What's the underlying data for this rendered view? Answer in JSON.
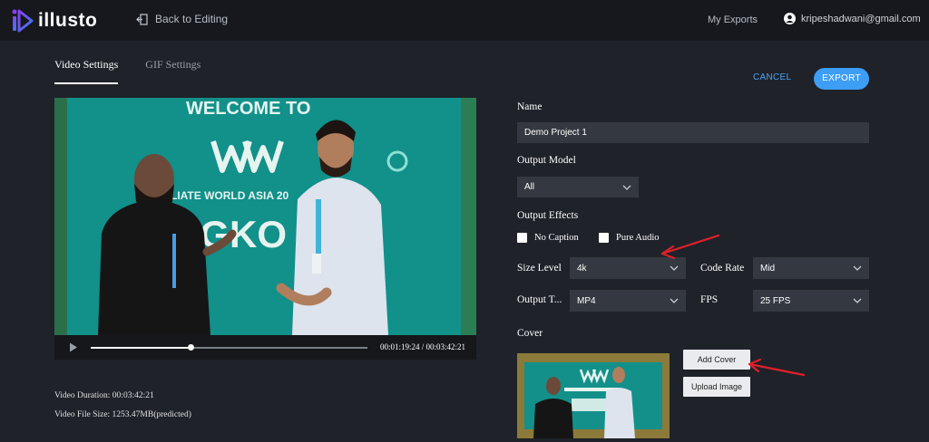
{
  "header": {
    "brand": "illusto",
    "back_label": "Back to Editing",
    "my_exports": "My Exports",
    "user_email": "kripeshadwani@gmail.com"
  },
  "tabs": [
    {
      "label": "Video Settings",
      "active": true
    },
    {
      "label": "GIF Settings",
      "active": false
    }
  ],
  "actions": {
    "cancel": "CANCEL",
    "export": "EXPORT"
  },
  "player": {
    "timecode": "00:01:19:24 / 00:03:42:21",
    "progress": 0.36,
    "banner_text": "WELCOME TO",
    "banner_sub": "FFILIATE WORLD ASIA 20",
    "banner_big": "NGKO"
  },
  "video_info": {
    "duration": "Video Duration: 00:03:42:21",
    "file_size": "Video File Size: 1253.47MB(predicted)"
  },
  "form": {
    "name_label": "Name",
    "name_value": "Demo Project 1",
    "output_model_label": "Output Model",
    "output_model_value": "All",
    "output_effects_label": "Output Effects",
    "no_caption": "No Caption",
    "pure_audio": "Pure Audio",
    "size_level_label": "Size Level",
    "size_level_value": "4k",
    "code_rate_label": "Code Rate",
    "code_rate_value": "Mid",
    "output_type_label": "Output T...",
    "output_type_value": "MP4",
    "fps_label": "FPS",
    "fps_value": "25 FPS",
    "cover_label": "Cover",
    "add_cover": "Add Cover",
    "upload_image": "Upload Image"
  },
  "colors": {
    "accent": "#3e9ef5",
    "background": "#1f2229",
    "topbar": "#16181d",
    "field": "#343840",
    "arrow": "#e0202a"
  }
}
